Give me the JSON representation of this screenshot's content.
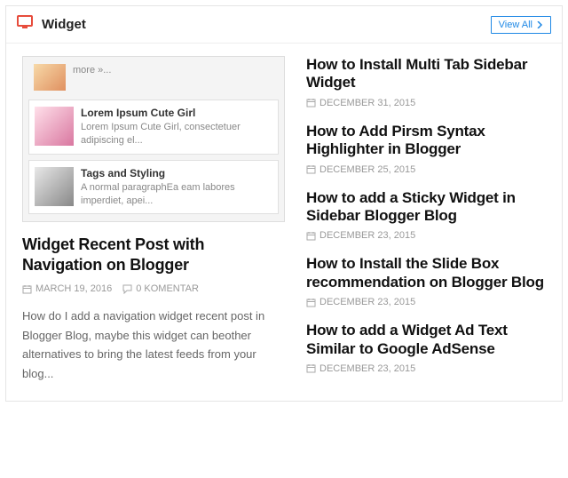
{
  "header": {
    "title": "Widget",
    "view_all": "View All"
  },
  "thumbnail_preview": {
    "row0_text": "more »...",
    "row1_title": "Lorem Ipsum Cute Girl",
    "row1_text": "Lorem Ipsum Cute Girl, consectetuer adipiscing el...",
    "row2_title": "Tags and Styling",
    "row2_text": "A normal paragraphEa eam labores imperdiet, apei..."
  },
  "main_post": {
    "title": "Widget Recent Post with Navigation on Blogger",
    "date": "MARCH 19, 2016",
    "comments": "0 KOMENTAR",
    "excerpt": "How do I add a navigation widget recent post in Blogger Blog, maybe this widget can beother alternatives to bring the latest feeds from your blog..."
  },
  "side_posts": [
    {
      "title": "How to Install Multi Tab Sidebar Widget",
      "date": "DECEMBER 31, 2015"
    },
    {
      "title": "How to Add Pirsm Syntax Highlighter in Blogger",
      "date": "DECEMBER 25, 2015"
    },
    {
      "title": "How to add a Sticky Widget in Sidebar Blogger Blog",
      "date": "DECEMBER 23, 2015"
    },
    {
      "title": "How to Install the Slide Box recommendation on Blogger Blog",
      "date": "DECEMBER 23, 2015"
    },
    {
      "title": "How to add a Widget Ad Text Similar to Google AdSense",
      "date": "DECEMBER 23, 2015"
    }
  ]
}
